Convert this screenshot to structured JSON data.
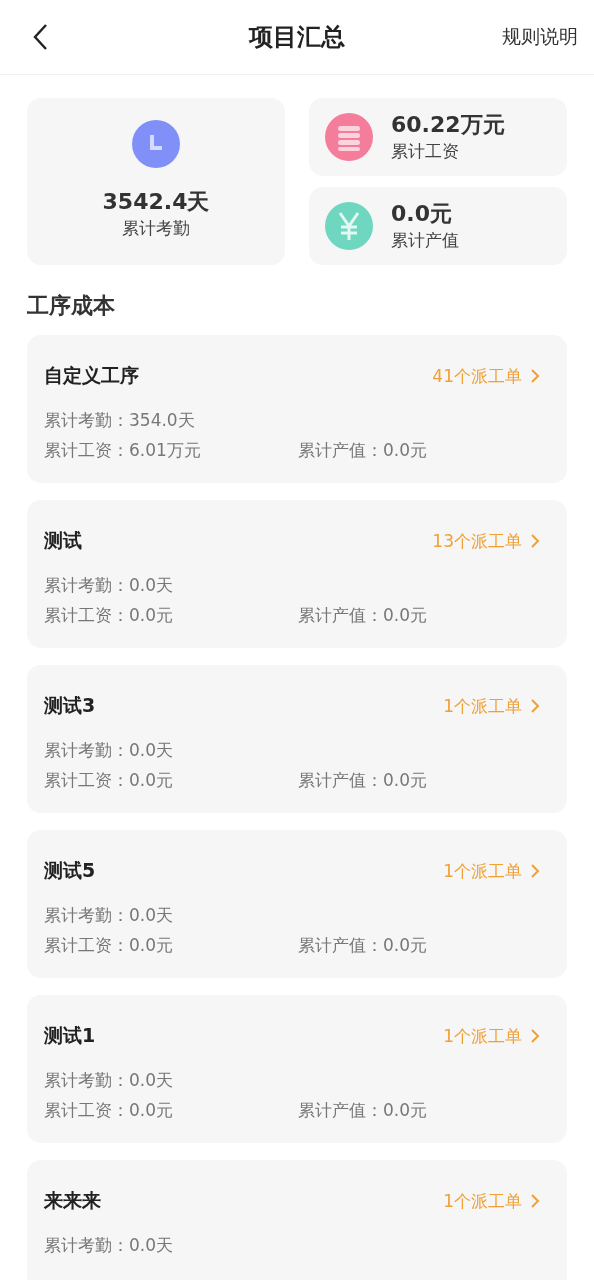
{
  "header": {
    "title": "项目汇总",
    "rules_link": "规则说明"
  },
  "summary": [
    {
      "kind": "clock",
      "value": "3542.4天",
      "label": "累计考勤"
    },
    {
      "kind": "coins",
      "value": "60.22万元",
      "label": "累计工资"
    },
    {
      "kind": "yen",
      "value": "0.0元",
      "label": "累计产值"
    }
  ],
  "section_title": "工序成本",
  "processes": [
    {
      "name": "自定义工序",
      "orders": "41个派工单",
      "attendance": "累计考勤：354.0天",
      "wages": "累计工资：6.01万元",
      "output": "累计产值：0.0元"
    },
    {
      "name": "测试",
      "orders": "13个派工单",
      "attendance": "累计考勤：0.0天",
      "wages": "累计工资：0.0元",
      "output": "累计产值：0.0元"
    },
    {
      "name": "测试3",
      "orders": "1个派工单",
      "attendance": "累计考勤：0.0天",
      "wages": "累计工资：0.0元",
      "output": "累计产值：0.0元"
    },
    {
      "name": "测试5",
      "orders": "1个派工单",
      "attendance": "累计考勤：0.0天",
      "wages": "累计工资：0.0元",
      "output": "累计产值：0.0元"
    },
    {
      "name": "测试1",
      "orders": "1个派工单",
      "attendance": "累计考勤：0.0天",
      "wages": "累计工资：0.0元",
      "output": "累计产值：0.0元"
    },
    {
      "name": "来来来",
      "orders": "1个派工单",
      "attendance": "累计考勤：0.0天"
    }
  ]
}
